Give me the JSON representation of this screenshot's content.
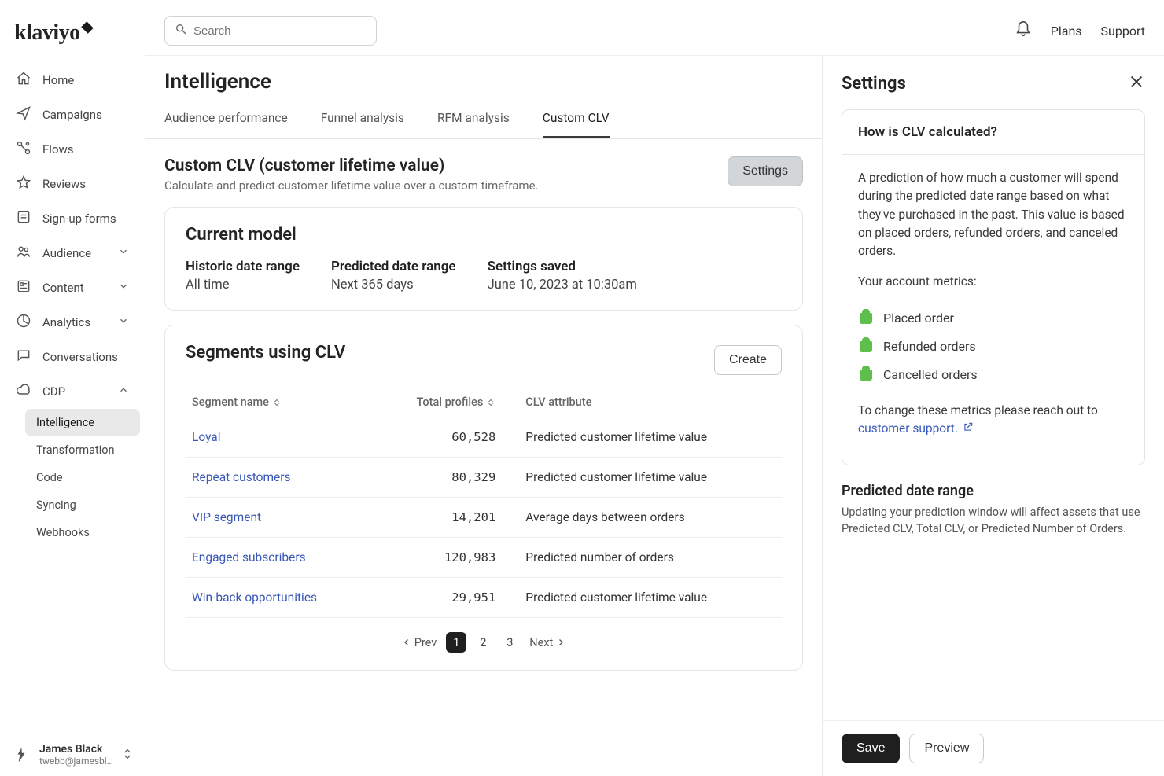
{
  "brand": "klaviyo",
  "header": {
    "search_placeholder": "Search",
    "links": {
      "plans": "Plans",
      "support": "Support"
    }
  },
  "sidebar": {
    "items": [
      {
        "label": "Home",
        "icon": "house"
      },
      {
        "label": "Campaigns",
        "icon": "send"
      },
      {
        "label": "Flows",
        "icon": "flow"
      },
      {
        "label": "Reviews",
        "icon": "star"
      },
      {
        "label": "Sign-up forms",
        "icon": "form"
      },
      {
        "label": "Audience",
        "icon": "people",
        "expandable": true
      },
      {
        "label": "Content",
        "icon": "content",
        "expandable": true
      },
      {
        "label": "Analytics",
        "icon": "analytics",
        "expandable": true
      },
      {
        "label": "Conversations",
        "icon": "chat"
      },
      {
        "label": "CDP",
        "icon": "cloud",
        "expanded": true
      }
    ],
    "sub": [
      "Intelligence",
      "Transformation",
      "Code",
      "Syncing",
      "Webhooks"
    ],
    "user": {
      "name": "James Black",
      "email": "twebb@jamesbl…"
    }
  },
  "page": {
    "title": "Intelligence",
    "tabs": [
      "Audience performance",
      "Funnel analysis",
      "RFM analysis",
      "Custom CLV"
    ],
    "active_tab": 3
  },
  "custom_clv": {
    "title": "Custom CLV (customer lifetime value)",
    "desc": "Calculate and predict customer lifetime value over a custom timeframe.",
    "settings_button": "Settings"
  },
  "model": {
    "heading": "Current model",
    "cells": [
      {
        "label": "Historic date range",
        "value": "All time"
      },
      {
        "label": "Predicted date range",
        "value": "Next 365 days"
      },
      {
        "label": "Settings saved",
        "value": "June 10, 2023 at 10:30am"
      }
    ]
  },
  "segments": {
    "heading": "Segments using CLV",
    "create": "Create",
    "cols": [
      "Segment name",
      "Total profiles",
      "CLV attribute"
    ],
    "rows": [
      {
        "name": "Loyal",
        "profiles": "60,528",
        "attr": "Predicted customer lifetime value"
      },
      {
        "name": "Repeat customers",
        "profiles": "80,329",
        "attr": "Predicted customer lifetime value"
      },
      {
        "name": "VIP segment",
        "profiles": "14,201",
        "attr": "Average days between orders"
      },
      {
        "name": "Engaged subscribers",
        "profiles": "120,983",
        "attr": "Predicted number of orders"
      },
      {
        "name": "Win-back opportunities",
        "profiles": "29,951",
        "attr": "Predicted customer lifetime value"
      }
    ],
    "pager": {
      "prev": "Prev",
      "next": "Next",
      "pages": [
        "1",
        "2",
        "3"
      ],
      "current": "1"
    }
  },
  "panel": {
    "title": "Settings",
    "info": {
      "heading": "How is CLV calculated?",
      "body": "A prediction of how much a customer will spend during the predicted date range based on what they've purchased in the past. This value is based on placed orders, refunded orders, and canceled orders.",
      "metrics_label": "Your account metrics:",
      "metrics": [
        "Placed order",
        "Refunded orders",
        "Cancelled orders"
      ],
      "change_text": "To change these metrics please reach out to ",
      "support_link": "customer support."
    },
    "predicted": {
      "heading": "Predicted date range",
      "sub": "Updating your prediction window will affect assets that use Predicted CLV, Total CLV, or Predicted Number of Orders."
    },
    "buttons": {
      "save": "Save",
      "preview": "Preview"
    }
  }
}
